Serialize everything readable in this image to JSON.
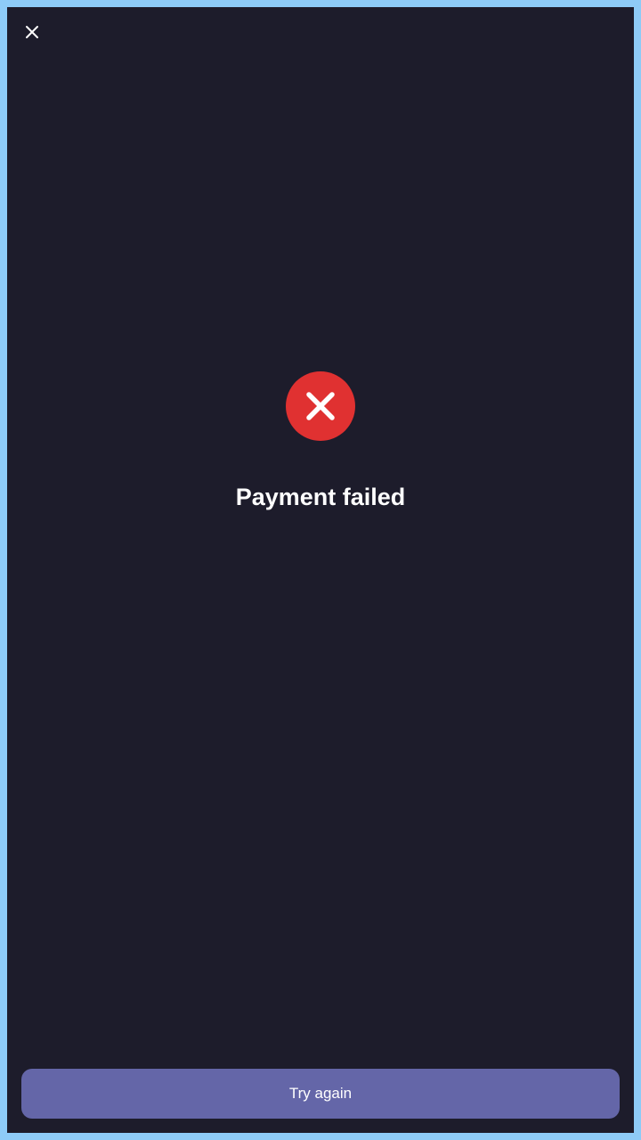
{
  "header": {
    "close_icon": "close-icon"
  },
  "status": {
    "icon": "x-icon",
    "color": "#e03131",
    "title": "Payment failed"
  },
  "footer": {
    "primary_button_label": "Try again",
    "primary_button_color": "#6466a8"
  },
  "theme": {
    "background": "#1d1c2b",
    "frame": "#8ecbf7"
  }
}
